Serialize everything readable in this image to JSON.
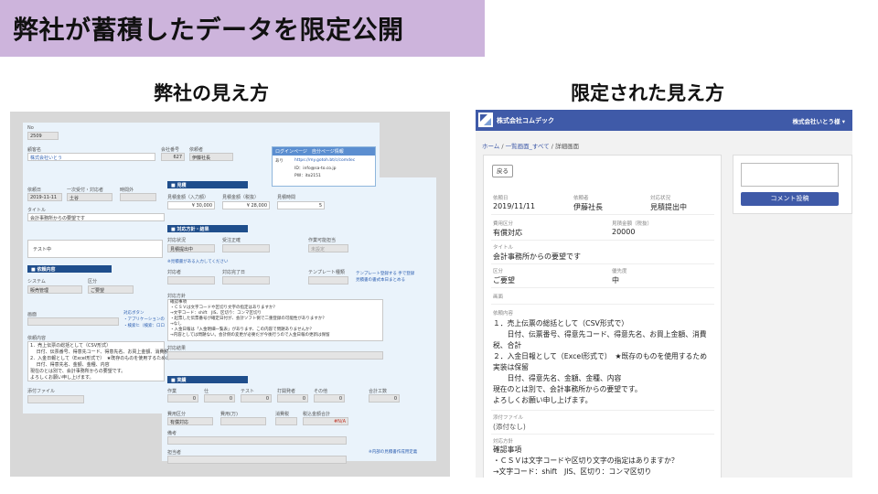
{
  "slide_title": "弊社が蓄積したデータを限定公開",
  "left_heading": "弊社の見え方",
  "right_heading": "限定された見え方",
  "internal": {
    "no_label": "No",
    "no_value": "2509",
    "client_label": "顧客名",
    "client_value": "株式会社いとう",
    "member_no_label": "会社番号",
    "member_no_value": "627",
    "requester_label": "依頼者",
    "requester_value": "伊藤社長",
    "panel_title": "ログインページ　自分ページ情報",
    "panel_flag": "あり",
    "panel_url": "https://my.gotoh.bt/c/comdec",
    "panel_id": "ID：info@sa-to.co.jp",
    "panel_pw": "PW：ito2151",
    "date_label": "依頼日",
    "date_value": "2019-11-11",
    "first_resp_label": "一次受付・対応者",
    "first_resp_value": "土谷",
    "hours_label": "時間外",
    "title_label": "タイトル",
    "title_value": "会計事務所からの要望です",
    "test_text": "テスト中",
    "sec_contents": "依頼内容",
    "system_label": "システム",
    "system_value": "販売管理",
    "category_label": "区分",
    "category_value": "ご要望",
    "screen_label": "画面",
    "screen_link1": "対応ボタン",
    "screen_link2": "・アプリケーションの",
    "screen_link3": "・検索ヒ（検索：ロロ",
    "request_label": "依頼内容",
    "req_lines": [
      "1．売上伝票の総括として（CSV形式）",
      "　 日付、伝票番号、得意先コード、得意先名、お買上金額、消費税、",
      "2．入金日報として（Excel形式で）　★既存のものを使用するための",
      "　 日付、得意先名、金額、金種、内容",
      "現在のとは別で、会計事務所からの要望です。",
      "よろしくお願い申し上げます。"
    ],
    "attach_label": "添付ファイル",
    "sec_estimate": "見積",
    "est_amt_label": "見積金額（入力額）",
    "est_amt_value": "¥ 30,000",
    "est_amt2_label": "見積金額（税抜）",
    "est_amt2_value": "¥ 28,000",
    "est_hours_label": "見積時間",
    "est_hours_value": "5",
    "sec_progress": "対応方針・結果",
    "status_label": "対応状況",
    "status_value": "見積提出中",
    "order_label": "受注正確",
    "partner_label": "作業可能担当",
    "partner_value": "未設定",
    "doc_link": "※見積書がある入力してください",
    "handler_label": "対応者",
    "due_label": "対応完了日",
    "template_label": "テンプレート種類",
    "tmpl_link1": "テンプレート登録する 手で登録",
    "tmpl_link2": "見積書の書式本日まとめる",
    "policy_label": "対応方針",
    "policy_lines": [
      "確認事項",
      "・ＣＳＶは文字コードや区切り文字の指定はありますか？",
      "→文字コード：shift　JIS、区切り：コンマ区切り",
      "・起票した伝票番号が確定日付が、会計ソフト側で二重登録の可能性がありますか？",
      "→なし",
      "・入金日報は「入金明細一覧表」があります、この内容で問題ありませんか？",
      "→内容としては問題ない。会計側の変更が必要だが今後行うので入金日報の更新は保留"
    ],
    "result_label": "対応結果",
    "sec_actual": "実績",
    "act_cols": [
      "作業",
      "仕",
      "テスト",
      "打開発者",
      "その他",
      "合計工数"
    ],
    "act_values": [
      "0",
      "0",
      "0",
      "0",
      "0",
      "0"
    ],
    "bill_cat_label": "費用区分",
    "bill_cat_value": "有償対応",
    "bill_amt_label": "費用(万)",
    "tax_label": "消費税",
    "total_label": "税込金額合計",
    "total_value": "#N/A",
    "note_label": "備考",
    "payee_label": "担当者",
    "footer_link": "※内部の見積書作成用定義"
  },
  "portal": {
    "company": "株式会社コムデック",
    "user_menu": "株式会社いとう様 ▾",
    "crumb_home": "ホーム",
    "crumb_list": "一覧画面_すべて",
    "crumb_detail": "詳細画面",
    "crumb_sep": "/",
    "back_button": "戻る",
    "comment_button": "コメント投稿",
    "date_label": "依頼日",
    "date_value": "2019/11/11",
    "requester_label": "依頼者",
    "requester_value": "伊藤社長",
    "status_label": "対応状況",
    "status_value": "見積提出中",
    "bill_label": "費用区分",
    "bill_value": "有償対応",
    "amount_label": "見積金額（税抜）",
    "amount_value": "20000",
    "title_label": "タイトル",
    "title_value": "会計事務所からの要望です",
    "category_label": "区分",
    "category_value": "ご要望",
    "priority_label": "優先度",
    "priority_value": "中",
    "screen_label": "画面",
    "content_label": "依頼内容",
    "content_lines": [
      "１．売上伝票の総括として（CSV形式で）",
      "　　日付、伝票番号、得意先コード、得意先名、お買上金額、消費",
      "税、合計",
      "２．入金日報として（Excel形式で）　★既存のものを使用するため",
      "実装は保留",
      "　　日付、得意先名、金額、金種、内容",
      "現在のとは別で、会計事務所からの要望です。",
      "よろしくお願い申し上げます。"
    ],
    "attach_label": "添付ファイル",
    "attach_value": "(添付なし)",
    "policy_label": "対応方針",
    "policy_lines": [
      "確認事項",
      "・ＣＳＶは文字コードや区切り文字の指定はありますか？",
      "→文字コード：shift　JIS、区切り：コンマ区切り"
    ]
  }
}
